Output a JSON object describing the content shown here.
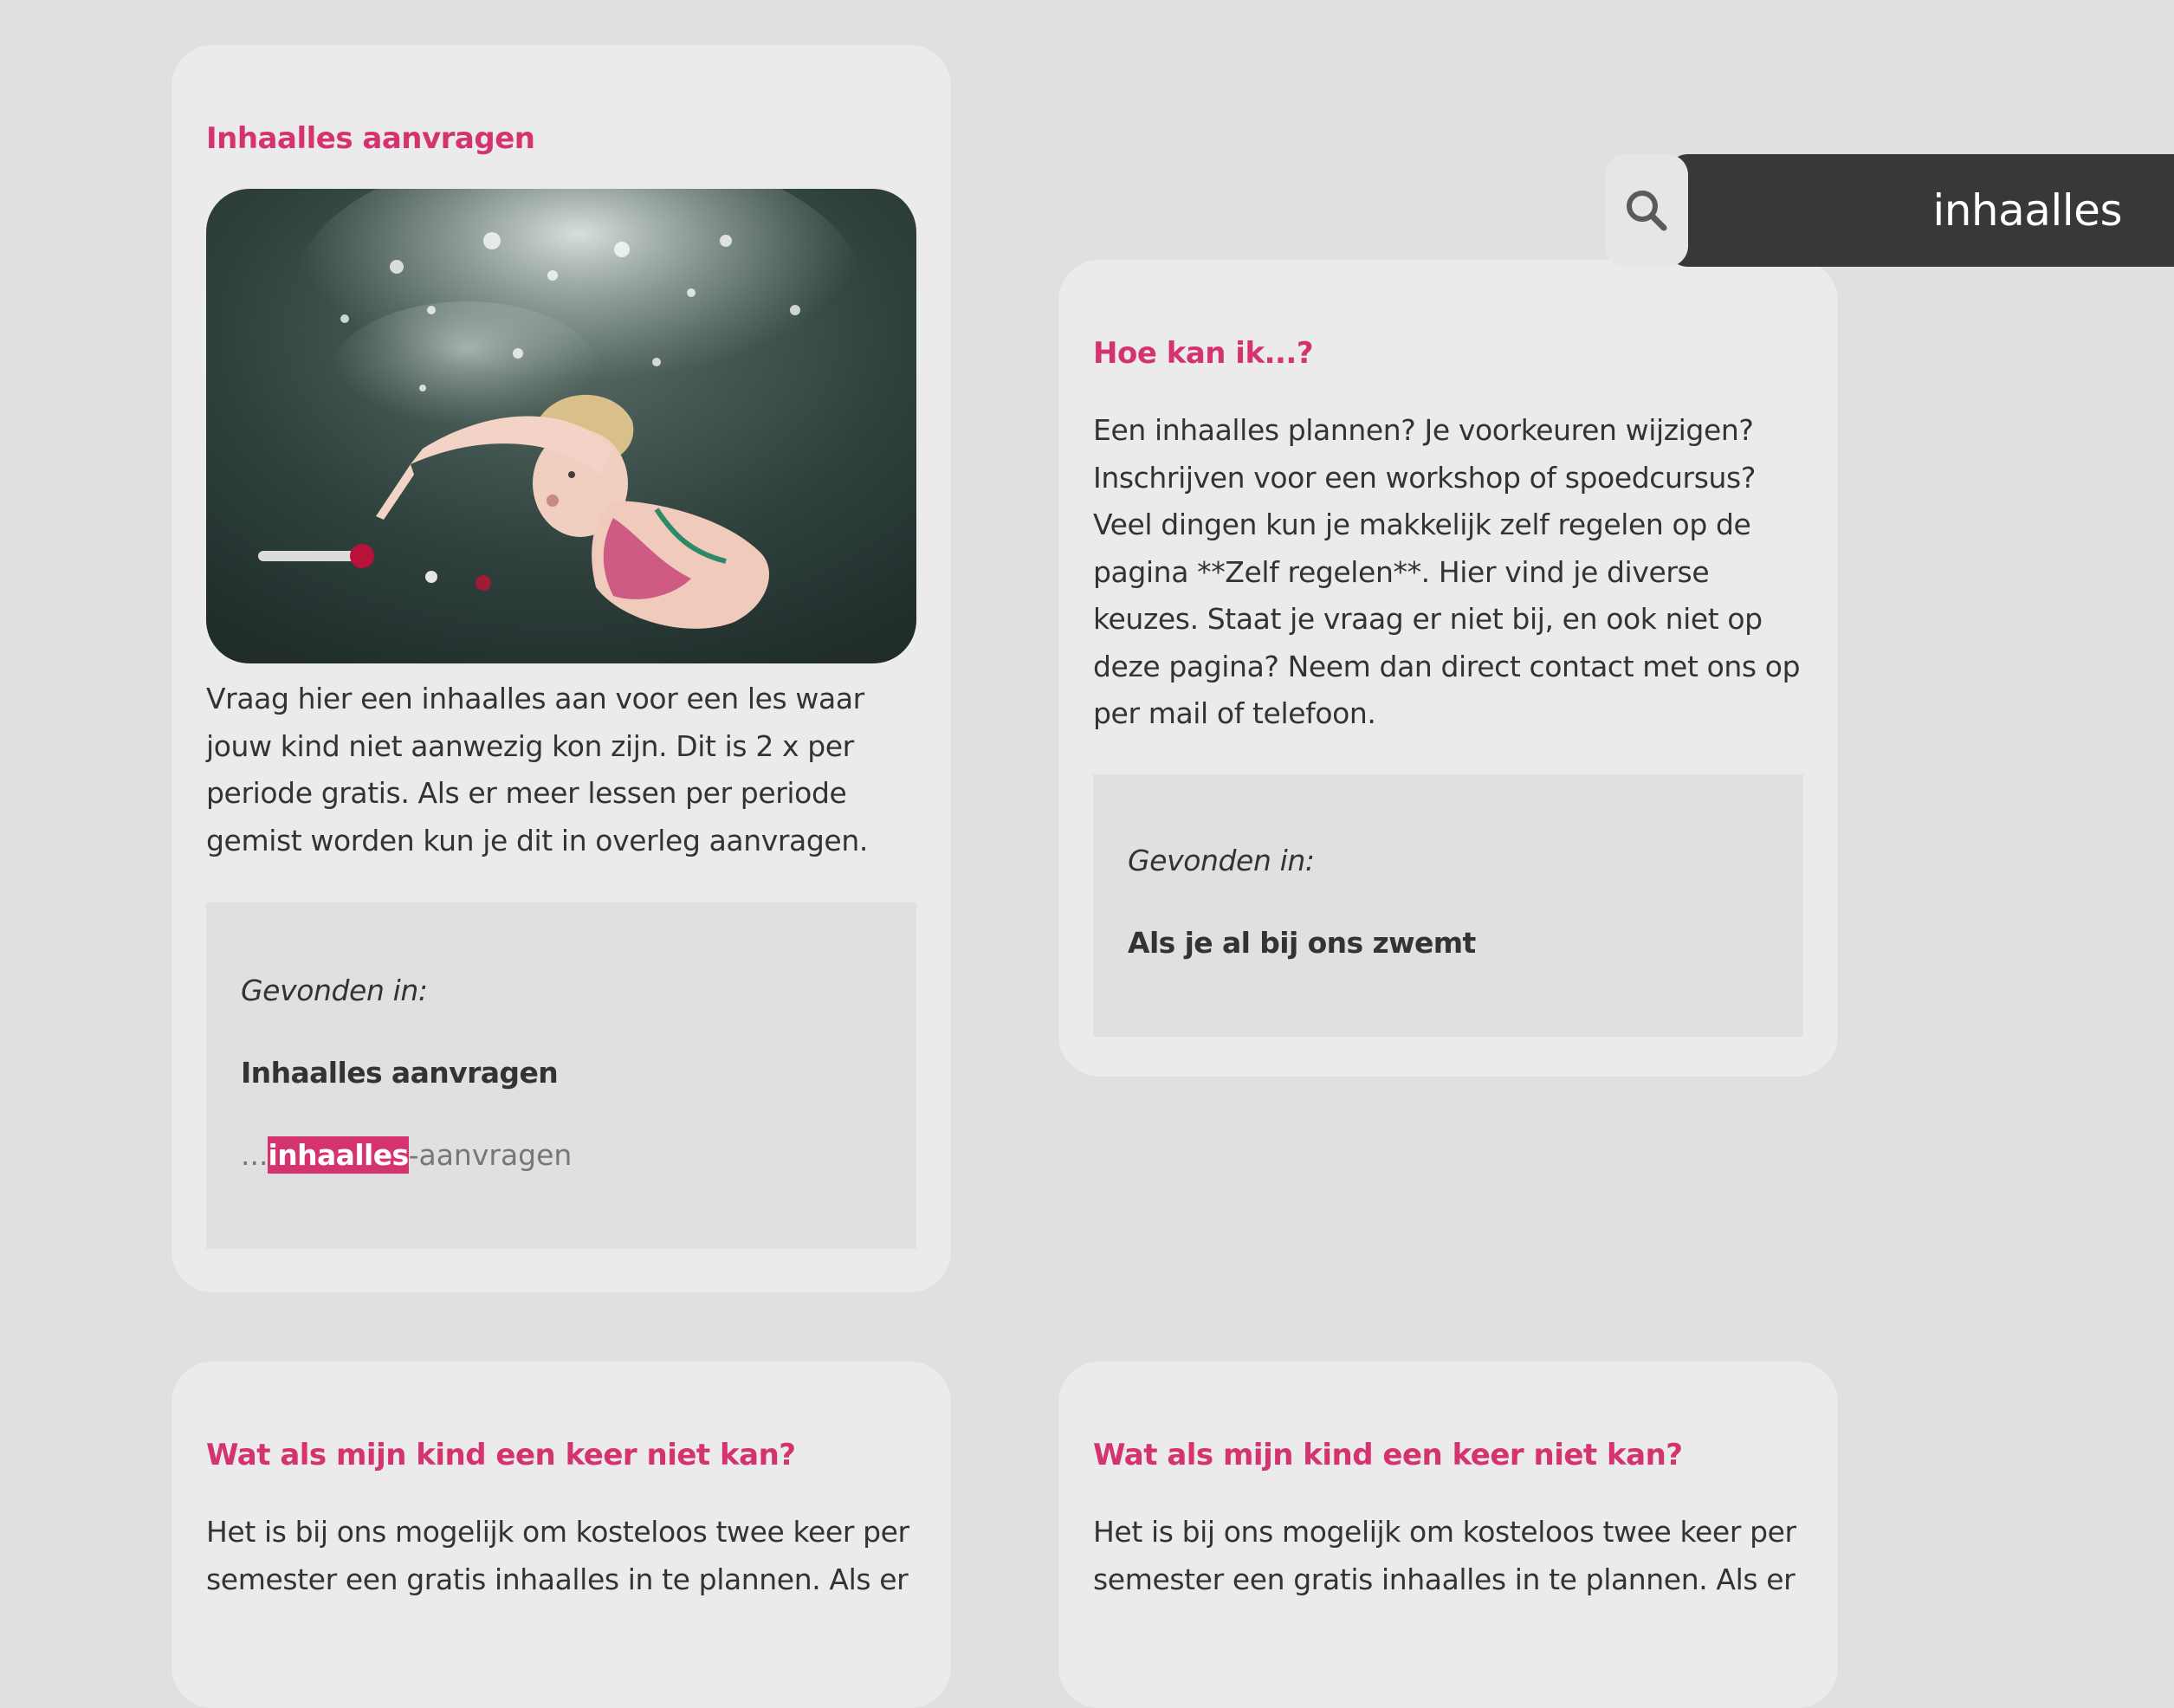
{
  "search": {
    "query": "inhaalles"
  },
  "colors": {
    "accent": "#d4336f",
    "page_background": "#e0e0e0",
    "card_background": "#ebebeb",
    "search_bar": "#383838"
  },
  "results": [
    {
      "title": "Inhaalles aanvragen",
      "image": "underwater-swimming-child-photo",
      "text": "Vraag hier een inhaalles aan voor een les waar jouw kind niet aanwezig kon zijn. Dit is 2 x per periode gratis. Als er meer lessen per periode gemist worden kun je dit in overleg aanvragen.",
      "found_label": "Gevonden in:",
      "found_page": "Inhaalles aanvragen",
      "snippet_prefix": "...",
      "snippet_match": "inhaalles",
      "snippet_suffix": "-aanvragen"
    },
    {
      "title": "Hoe kan ik...?",
      "text": "Een inhaalles plannen? Je voorkeuren wijzigen? Inschrijven voor een workshop of spoedcursus? Veel dingen kun je makkelijk zelf regelen op de pagina **Zelf regelen**. Hier vind je diverse keuzes. Staat je vraag er niet bij, en ook niet op deze pagina? Neem dan direct contact met ons op per mail of telefoon.",
      "found_label": "Gevonden in:",
      "found_page": "Als je al bij ons zwemt"
    },
    {
      "title": "Wat als mijn kind een keer niet kan?",
      "text": "Het is bij ons mogelijk om kosteloos twee keer per semester een gratis inhaalles in te plannen. Als er"
    },
    {
      "title": "Wat als mijn kind een keer niet kan?",
      "text": "Het is bij ons mogelijk om kosteloos twee keer per semester een gratis inhaalles in te plannen. Als er"
    }
  ]
}
